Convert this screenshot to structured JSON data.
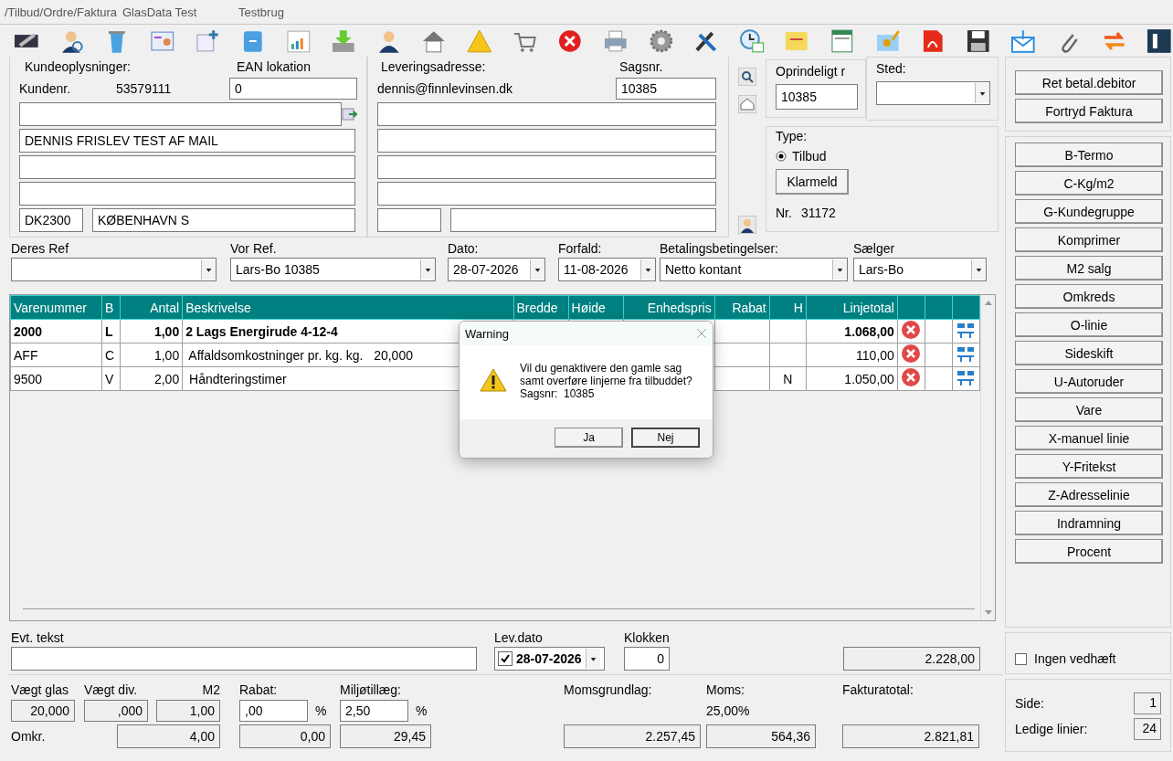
{
  "title_bar": {
    "path": "/Tilbud/Ordre/Faktura",
    "app": "GlasData Test",
    "user": "Testbrug"
  },
  "customer": {
    "heading": "Kundeoplysninger:",
    "number_label": "Kundenr.",
    "number": "53579111",
    "ean_label": "EAN lokation",
    "ean": "0",
    "name": "DENNIS FRISLEV TEST AF MAIL",
    "zip": "DK2300",
    "city": "KØBENHAVN S"
  },
  "delivery": {
    "heading": "Leveringsadresse:",
    "email": "dennis@finnlevinsen.dk",
    "case_label": "Sagsnr.",
    "case_no": "10385"
  },
  "original": {
    "label": "Oprindeligt r",
    "value": "10385"
  },
  "place": {
    "label": "Sted:"
  },
  "type": {
    "label": "Type:",
    "option": "Tilbud",
    "selected": true,
    "button": "Klarmeld",
    "nr_label": "Nr.",
    "nr": "31172"
  },
  "refs": [
    {
      "label": "Deres Ref"
    },
    {
      "label": "Vor Ref.",
      "value": "Lars-Bo 10385"
    },
    {
      "label": "Dato:",
      "value": "28-07-2026"
    },
    {
      "label": "Forfald:",
      "value": "11-08-2026"
    },
    {
      "label": "Betalingsbetingelser:",
      "value": "Netto kontant"
    },
    {
      "label": "Sælger",
      "value": "Lars-Bo"
    }
  ],
  "table": {
    "columns": [
      "Varenummer",
      "B",
      "Antal",
      "Beskrivelse",
      "Bredde",
      "Høide",
      "Enhedspris",
      "Rabat",
      "H",
      "Linjetotal"
    ],
    "rows": [
      {
        "item": "2000",
        "b": "L",
        "qty": "1,00",
        "description": "2 Lags Energirude 4-12-4",
        "total": "1.068,00",
        "bold": true
      },
      {
        "item": "AFF",
        "b": "C",
        "qty": "1,00",
        "description": " Affaldsomkostninger pr. kg. kg.   20,000",
        "total": "110,00",
        "bold": false
      },
      {
        "item": "9500",
        "b": "V",
        "qty": "2,00",
        "description": " Håndteringstimer",
        "h": "N",
        "total": "1.050,00",
        "bold": false
      }
    ]
  },
  "dialog": {
    "title": "Warning",
    "lines": [
      "Vil du genaktivere den gamle sag",
      "samt overføre linjerne fra tilbuddet?"
    ],
    "case_line": "Sagsnr:  10385",
    "buttons": [
      {
        "label": "Ja",
        "default": false
      },
      {
        "label": "Nej",
        "default": true
      }
    ]
  },
  "note": {
    "label": "Evt. tekst"
  },
  "delivery_date": {
    "label": "Lev.dato",
    "checked": true,
    "value": "28-07-2026"
  },
  "clock": {
    "label": "Klokken",
    "value": "0"
  },
  "subtotal": "2.228,00",
  "weights": [
    {
      "label": "Vægt glas",
      "value": "20,000"
    },
    {
      "label": "Vægt div.",
      "value": ",000"
    },
    {
      "label": "M2",
      "value": "1,00"
    }
  ],
  "costs": {
    "label": "Omkr.",
    "value": "4,00"
  },
  "discount": {
    "label": "Rabat:",
    "value": ",00",
    "unit": "%",
    "amount": "0,00"
  },
  "environment": {
    "label": "Miljøtillæg:",
    "value": "2,50",
    "unit": "%",
    "amount": "29,45"
  },
  "vat_base": {
    "label": "Momsgrundlag:",
    "value": "2.257,45"
  },
  "vat": {
    "label": "Moms:",
    "rate": "25,00%",
    "value": "564,36"
  },
  "invoice_total": {
    "label": "Fakturatotal:",
    "value": "2.821,81"
  },
  "top_buttons": [
    "Ret betal.debitor",
    "Fortryd Faktura"
  ],
  "side_buttons": [
    "B-Termo",
    "C-Kg/m2",
    "G-Kundegruppe",
    "Komprimer",
    "M2 salg",
    "Omkreds",
    "O-linie",
    "Sideskift",
    "U-Autoruder",
    "Vare",
    "X-manuel linie",
    "Y-Fritekst",
    "Z-Adresselinie",
    "Indramning",
    "Procent"
  ],
  "no_attachment": {
    "label": "Ingen vedhæft",
    "checked": false
  },
  "page": {
    "label": "Side:",
    "value": "1"
  },
  "free_lines": {
    "label": "Ledige linier:",
    "value": "24"
  }
}
